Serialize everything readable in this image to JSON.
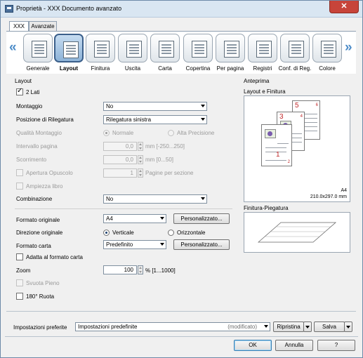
{
  "window": {
    "title": "Proprietà - XXX Documento avanzato",
    "close_label": "✕"
  },
  "tabs": [
    {
      "label": "XXX"
    },
    {
      "label": "Avanzate"
    }
  ],
  "nav": {
    "items": [
      {
        "label": "Generale",
        "icon": "general-icon"
      },
      {
        "label": "Layout",
        "icon": "layout-icon"
      },
      {
        "label": "Finitura",
        "icon": "finishing-icon"
      },
      {
        "label": "Uscita",
        "icon": "output-icon"
      },
      {
        "label": "Carta",
        "icon": "paper-icon"
      },
      {
        "label": "Copertina",
        "icon": "cover-icon"
      },
      {
        "label": "Per pagina",
        "icon": "per-page-icon"
      },
      {
        "label": "Registri",
        "icon": "tabs-icon"
      },
      {
        "label": "Conf. di Reg.",
        "icon": "registration-icon"
      },
      {
        "label": "Colore",
        "icon": "color-icon"
      }
    ],
    "left_arrow": "«",
    "right_arrow": "»"
  },
  "layout": {
    "group_label": "Layout",
    "due_lati": {
      "label": "2 Lati",
      "checked": true
    },
    "montaggio": {
      "label": "Montaggio",
      "value": "No"
    },
    "posizione_rilegatura": {
      "label": "Posizione di Rilegatura",
      "value": "Rilegatura sinistra"
    },
    "qualita_montaggio": {
      "label": "Qualità Montaggio",
      "opt1": "Normale",
      "opt2": "Alta Precisione"
    },
    "intervallo_pagina": {
      "label": "Intervallo pagina",
      "value": "0,0",
      "range": "mm [-250...250]"
    },
    "scorrimento": {
      "label": "Scorrimento",
      "value": "0,0",
      "range": "mm [0...50]"
    },
    "apertura_opuscolo": {
      "label": "Apertura Opuscolo",
      "value": "1",
      "unit": "Pagine per sezione"
    },
    "ampiezza_libro": {
      "label": "Ampiezza libro"
    },
    "combinazione": {
      "label": "Combinazione",
      "value": "No"
    },
    "formato_originale": {
      "label": "Formato originale",
      "value": "A4",
      "button": "Personalizzato..."
    },
    "direzione_originale": {
      "label": "Direzione originale",
      "opt1": "Verticale",
      "opt2": "Orizzontale"
    },
    "formato_carta": {
      "label": "Formato carta",
      "value": "Predefinito",
      "button": "Personalizzato..."
    },
    "adatta_formato": {
      "label": "Adatta al formato carta"
    },
    "zoom": {
      "label": "Zoom",
      "value": "100",
      "range": "% [1...1000]"
    },
    "svuota_pieno": {
      "label": "Svuota Pieno"
    },
    "ruota_180": {
      "label": "180° Ruota"
    }
  },
  "preview": {
    "group_label": "Anteprima",
    "layout_label": "Layout e Finitura",
    "paper_name": "A4",
    "paper_size": "210.0x297.0 mm",
    "finishing_label": "Finitura-Piegatura",
    "page_numbers": [
      "5",
      "6",
      "3",
      "4",
      "1",
      "2"
    ]
  },
  "preferences": {
    "label": "Impostazioni preferite",
    "value": "Impostazioni predefinite",
    "modified": "(modificato)",
    "restore": "Ripristina",
    "save": "Salva"
  },
  "footer": {
    "ok": "OK",
    "cancel": "Annulla",
    "help": "?"
  }
}
